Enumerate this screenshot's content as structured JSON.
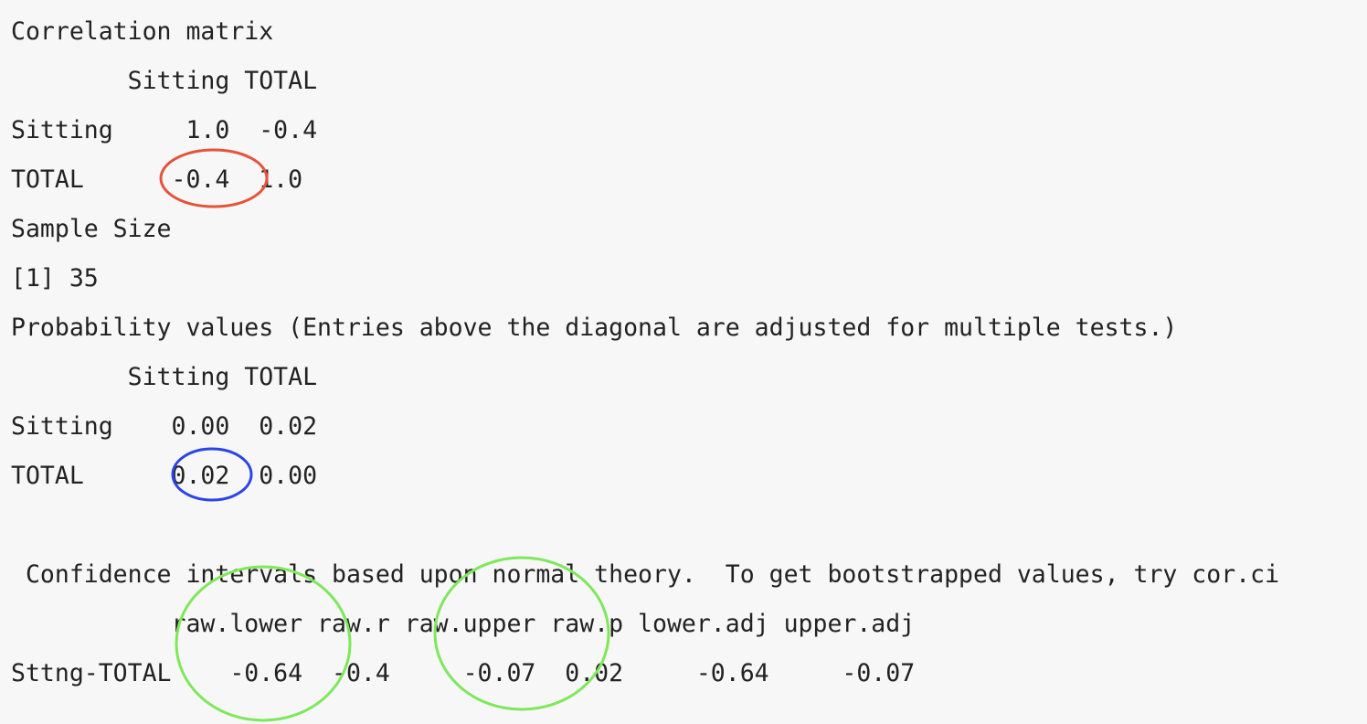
{
  "output": {
    "corr_header": "Correlation matrix",
    "corr_cols": "        Sitting TOTAL",
    "corr_row_sitting": "Sitting     1.0  -0.4",
    "corr_row_total": "TOTAL      -0.4  1.0",
    "sample_header": "Sample Size",
    "sample_value": "[1] 35",
    "prob_header": "Probability values (Entries above the diagonal are adjusted for multiple tests.)",
    "prob_cols": "        Sitting TOTAL",
    "prob_row_sitting": "Sitting    0.00  0.02",
    "prob_row_total": "TOTAL      0.02  0.00",
    "blank": "",
    "ci_header": " Confidence intervals based upon normal theory.  To get bootstrapped values, try cor.ci",
    "ci_cols": "           raw.lower raw.r raw.upper raw.p lower.adj upper.adj",
    "ci_row": "Sttng-TOTAL    -0.64  -0.4     -0.07  0.02     -0.64     -0.07"
  },
  "annotation_colors": {
    "correlation_circle": "#e5533a",
    "p_value_circle": "#2a44e8",
    "ci_circles": "#7ee85a"
  }
}
